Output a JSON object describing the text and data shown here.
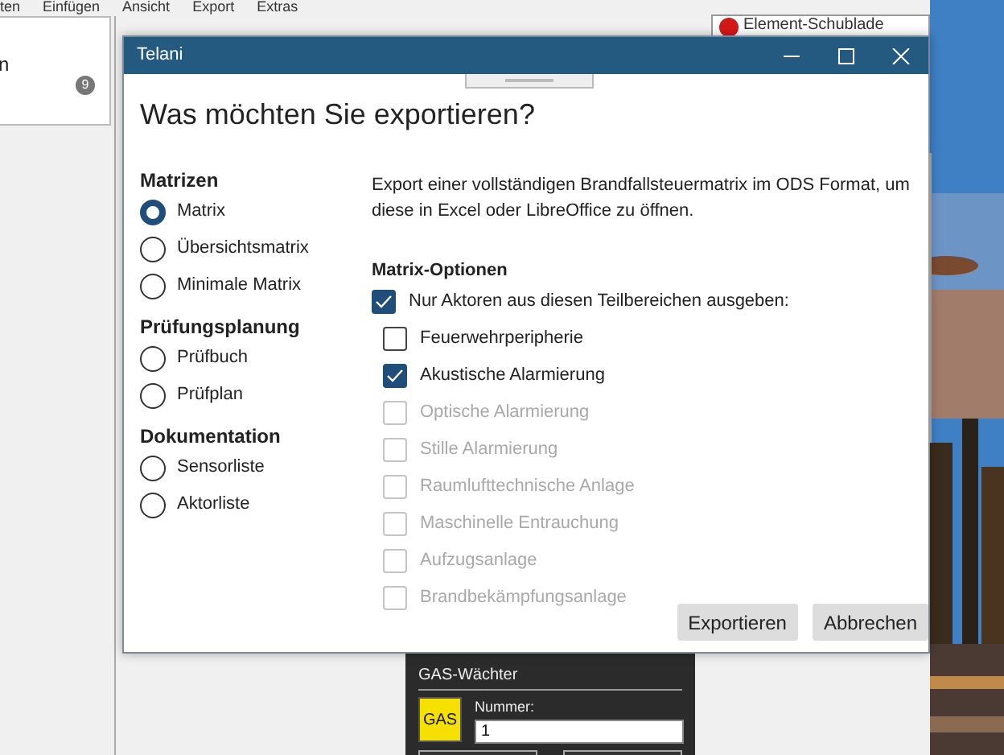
{
  "background_app": {
    "menu": [
      "ten",
      "Einfügen",
      "Ansicht",
      "Export",
      "Extras"
    ],
    "side_panel": {
      "text": "n",
      "badge": "9"
    },
    "drawer": {
      "title": "Element-Schublade"
    },
    "gas_panel": {
      "title": "GAS-Wächter",
      "icon_text": "GAS",
      "field_label": "Nummer:",
      "field_value": "1"
    }
  },
  "dialog": {
    "title": "Telani",
    "heading": "Was möchten Sie exportieren?",
    "groups": [
      {
        "title": "Matrizen",
        "options": [
          {
            "label": "Matrix",
            "selected": true
          },
          {
            "label": "Übersichtsmatrix",
            "selected": false
          },
          {
            "label": "Minimale Matrix",
            "selected": false
          }
        ]
      },
      {
        "title": "Prüfungsplanung",
        "options": [
          {
            "label": "Prüfbuch",
            "selected": false
          },
          {
            "label": "Prüfplan",
            "selected": false
          }
        ]
      },
      {
        "title": "Dokumentation",
        "options": [
          {
            "label": "Sensorliste",
            "selected": false
          },
          {
            "label": "Aktorliste",
            "selected": false
          }
        ]
      }
    ],
    "description": "Export einer vollständigen Brandfallsteuermatrix im ODS Format, um diese in Excel oder LibreOffice zu öffnen.",
    "options_title": "Matrix-Optionen",
    "main_option": {
      "label": "Nur Aktoren aus diesen Teilbereichen ausgeben:",
      "checked": true
    },
    "sub_options": [
      {
        "label": "Feuerwehrperipherie",
        "checked": false,
        "disabled": false
      },
      {
        "label": "Akustische Alarmierung",
        "checked": true,
        "disabled": false
      },
      {
        "label": "Optische Alarmierung",
        "checked": false,
        "disabled": true
      },
      {
        "label": "Stille Alarmierung",
        "checked": false,
        "disabled": true
      },
      {
        "label": "Raumlufttechnische Anlage",
        "checked": false,
        "disabled": true
      },
      {
        "label": "Maschinelle Entrauchung",
        "checked": false,
        "disabled": true
      },
      {
        "label": "Aufzugsanlage",
        "checked": false,
        "disabled": true
      },
      {
        "label": "Brandbekämpfungsanlage",
        "checked": false,
        "disabled": true
      }
    ],
    "buttons": [
      "Exportieren",
      "Abbrechen"
    ]
  }
}
